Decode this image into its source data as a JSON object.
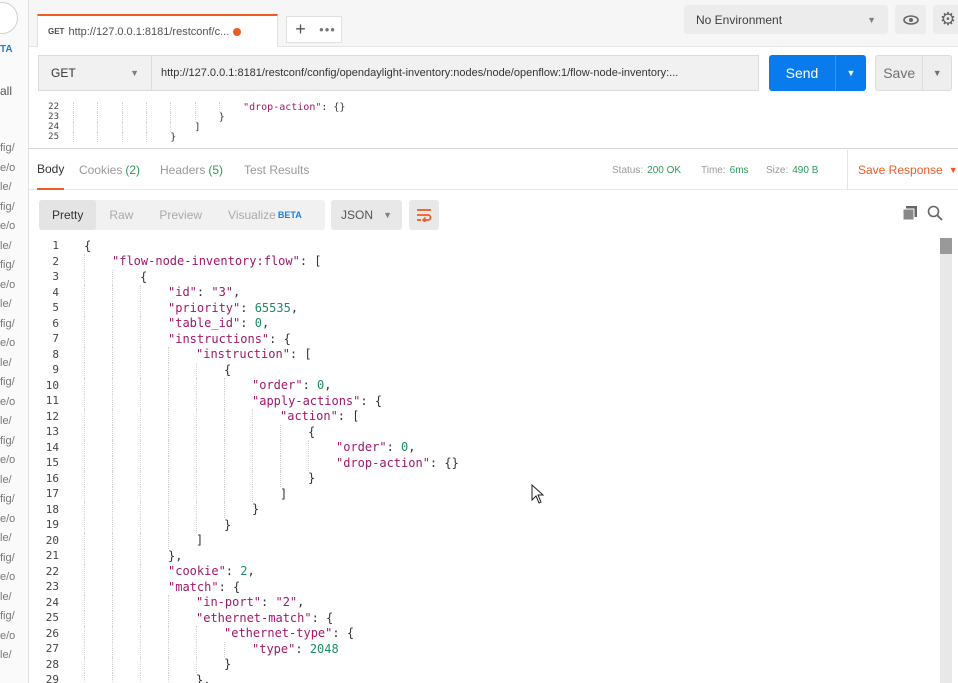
{
  "sidebar": {
    "beta_badge": "TA",
    "all_label": "all",
    "fragments": [
      "fig/",
      "e/o",
      "le/",
      "fig/",
      "e/o",
      "le/",
      "fig/",
      "e/o",
      "le/",
      "fig/",
      "e/o",
      "le/",
      "fig/",
      "e/o",
      "le/",
      "fig/",
      "e/o",
      "le/",
      "fig/",
      "e/o",
      "le/",
      "fig/",
      "e/o",
      "le/",
      "fig/",
      "e/o",
      "le/"
    ]
  },
  "tab": {
    "method": "GET",
    "url": "http://127.0.0.1:8181/restconf/c...",
    "accent_color": "#ef5b25"
  },
  "topbar": {
    "new_tab_icon": "plus-icon",
    "more_icon": "more-icon",
    "environment": "No Environment",
    "eye_icon": "eye-icon",
    "settings_icon": "gear-icon"
  },
  "request": {
    "method": "GET",
    "url": "http://127.0.0.1:8181/restconf/config/opendaylight-inventory:nodes/node/openflow:1/flow-node-inventory:...",
    "send_label": "Send",
    "save_label": "Save",
    "send_color": "#097bed"
  },
  "request_body_lines": [
    {
      "num": "22",
      "indent": 7,
      "parts": [
        [
          "s",
          "\"drop-action\""
        ],
        [
          "p",
          ": {}"
        ]
      ]
    },
    {
      "num": "23",
      "indent": 6,
      "parts": [
        [
          "p",
          "}"
        ]
      ]
    },
    {
      "num": "24",
      "indent": 5,
      "parts": [
        [
          "p",
          "]"
        ]
      ]
    },
    {
      "num": "25",
      "indent": 4,
      "parts": [
        [
          "p",
          "}"
        ]
      ]
    }
  ],
  "response_tabs": [
    {
      "label": "Body",
      "count": "",
      "active": true
    },
    {
      "label": "Cookies",
      "count": "(2)",
      "active": false
    },
    {
      "label": "Headers",
      "count": "(5)",
      "active": false
    },
    {
      "label": "Test Results",
      "count": "",
      "active": false
    }
  ],
  "response_meta": {
    "status_label": "Status:",
    "status_value": "200 OK",
    "time_label": "Time:",
    "time_value": "6ms",
    "size_label": "Size:",
    "size_value": "490 B",
    "save_response": "Save Response"
  },
  "view_modes": [
    {
      "label": "Pretty",
      "active": true,
      "badge": ""
    },
    {
      "label": "Raw",
      "active": false,
      "badge": ""
    },
    {
      "label": "Preview",
      "active": false,
      "badge": ""
    },
    {
      "label": "Visualize",
      "active": false,
      "badge": "BETA"
    }
  ],
  "format": "JSON",
  "response_body_lines": [
    {
      "num": "1",
      "indent": 0,
      "parts": [
        [
          "p",
          "{"
        ]
      ]
    },
    {
      "num": "2",
      "indent": 1,
      "parts": [
        [
          "s",
          "\"flow-node-inventory:flow\""
        ],
        [
          "p",
          ": ["
        ]
      ]
    },
    {
      "num": "3",
      "indent": 2,
      "parts": [
        [
          "p",
          "{"
        ]
      ]
    },
    {
      "num": "4",
      "indent": 3,
      "parts": [
        [
          "s",
          "\"id\""
        ],
        [
          "p",
          ": "
        ],
        [
          "s",
          "\"3\""
        ],
        [
          "p",
          ","
        ]
      ]
    },
    {
      "num": "5",
      "indent": 3,
      "parts": [
        [
          "s",
          "\"priority\""
        ],
        [
          "p",
          ": "
        ],
        [
          "n",
          "65535"
        ],
        [
          "p",
          ","
        ]
      ]
    },
    {
      "num": "6",
      "indent": 3,
      "parts": [
        [
          "s",
          "\"table_id\""
        ],
        [
          "p",
          ": "
        ],
        [
          "n",
          "0"
        ],
        [
          "p",
          ","
        ]
      ]
    },
    {
      "num": "7",
      "indent": 3,
      "parts": [
        [
          "s",
          "\"instructions\""
        ],
        [
          "p",
          ": {"
        ]
      ]
    },
    {
      "num": "8",
      "indent": 4,
      "parts": [
        [
          "s",
          "\"instruction\""
        ],
        [
          "p",
          ": ["
        ]
      ]
    },
    {
      "num": "9",
      "indent": 5,
      "parts": [
        [
          "p",
          "{"
        ]
      ]
    },
    {
      "num": "10",
      "indent": 6,
      "parts": [
        [
          "s",
          "\"order\""
        ],
        [
          "p",
          ": "
        ],
        [
          "n",
          "0"
        ],
        [
          "p",
          ","
        ]
      ]
    },
    {
      "num": "11",
      "indent": 6,
      "parts": [
        [
          "s",
          "\"apply-actions\""
        ],
        [
          "p",
          ": {"
        ]
      ]
    },
    {
      "num": "12",
      "indent": 7,
      "parts": [
        [
          "s",
          "\"action\""
        ],
        [
          "p",
          ": ["
        ]
      ]
    },
    {
      "num": "13",
      "indent": 8,
      "parts": [
        [
          "p",
          "{"
        ]
      ]
    },
    {
      "num": "14",
      "indent": 9,
      "parts": [
        [
          "s",
          "\"order\""
        ],
        [
          "p",
          ": "
        ],
        [
          "n",
          "0"
        ],
        [
          "p",
          ","
        ]
      ]
    },
    {
      "num": "15",
      "indent": 9,
      "parts": [
        [
          "s",
          "\"drop-action\""
        ],
        [
          "p",
          ": {}"
        ]
      ]
    },
    {
      "num": "16",
      "indent": 8,
      "parts": [
        [
          "p",
          "}"
        ]
      ]
    },
    {
      "num": "17",
      "indent": 7,
      "parts": [
        [
          "p",
          "]"
        ]
      ]
    },
    {
      "num": "18",
      "indent": 6,
      "parts": [
        [
          "p",
          "}"
        ]
      ]
    },
    {
      "num": "19",
      "indent": 5,
      "parts": [
        [
          "p",
          "}"
        ]
      ]
    },
    {
      "num": "20",
      "indent": 4,
      "parts": [
        [
          "p",
          "]"
        ]
      ]
    },
    {
      "num": "21",
      "indent": 3,
      "parts": [
        [
          "p",
          "},"
        ]
      ]
    },
    {
      "num": "22",
      "indent": 3,
      "parts": [
        [
          "s",
          "\"cookie\""
        ],
        [
          "p",
          ": "
        ],
        [
          "n",
          "2"
        ],
        [
          "p",
          ","
        ]
      ]
    },
    {
      "num": "23",
      "indent": 3,
      "parts": [
        [
          "s",
          "\"match\""
        ],
        [
          "p",
          ": {"
        ]
      ]
    },
    {
      "num": "24",
      "indent": 4,
      "parts": [
        [
          "s",
          "\"in-port\""
        ],
        [
          "p",
          ": "
        ],
        [
          "s",
          "\"2\""
        ],
        [
          "p",
          ","
        ]
      ]
    },
    {
      "num": "25",
      "indent": 4,
      "parts": [
        [
          "s",
          "\"ethernet-match\""
        ],
        [
          "p",
          ": {"
        ]
      ]
    },
    {
      "num": "26",
      "indent": 5,
      "parts": [
        [
          "s",
          "\"ethernet-type\""
        ],
        [
          "p",
          ": {"
        ]
      ]
    },
    {
      "num": "27",
      "indent": 6,
      "parts": [
        [
          "s",
          "\"type\""
        ],
        [
          "p",
          ": "
        ],
        [
          "n",
          "2048"
        ]
      ]
    },
    {
      "num": "28",
      "indent": 5,
      "parts": [
        [
          "p",
          "}"
        ]
      ]
    },
    {
      "num": "29",
      "indent": 4,
      "parts": [
        [
          "p",
          "},"
        ]
      ]
    }
  ]
}
